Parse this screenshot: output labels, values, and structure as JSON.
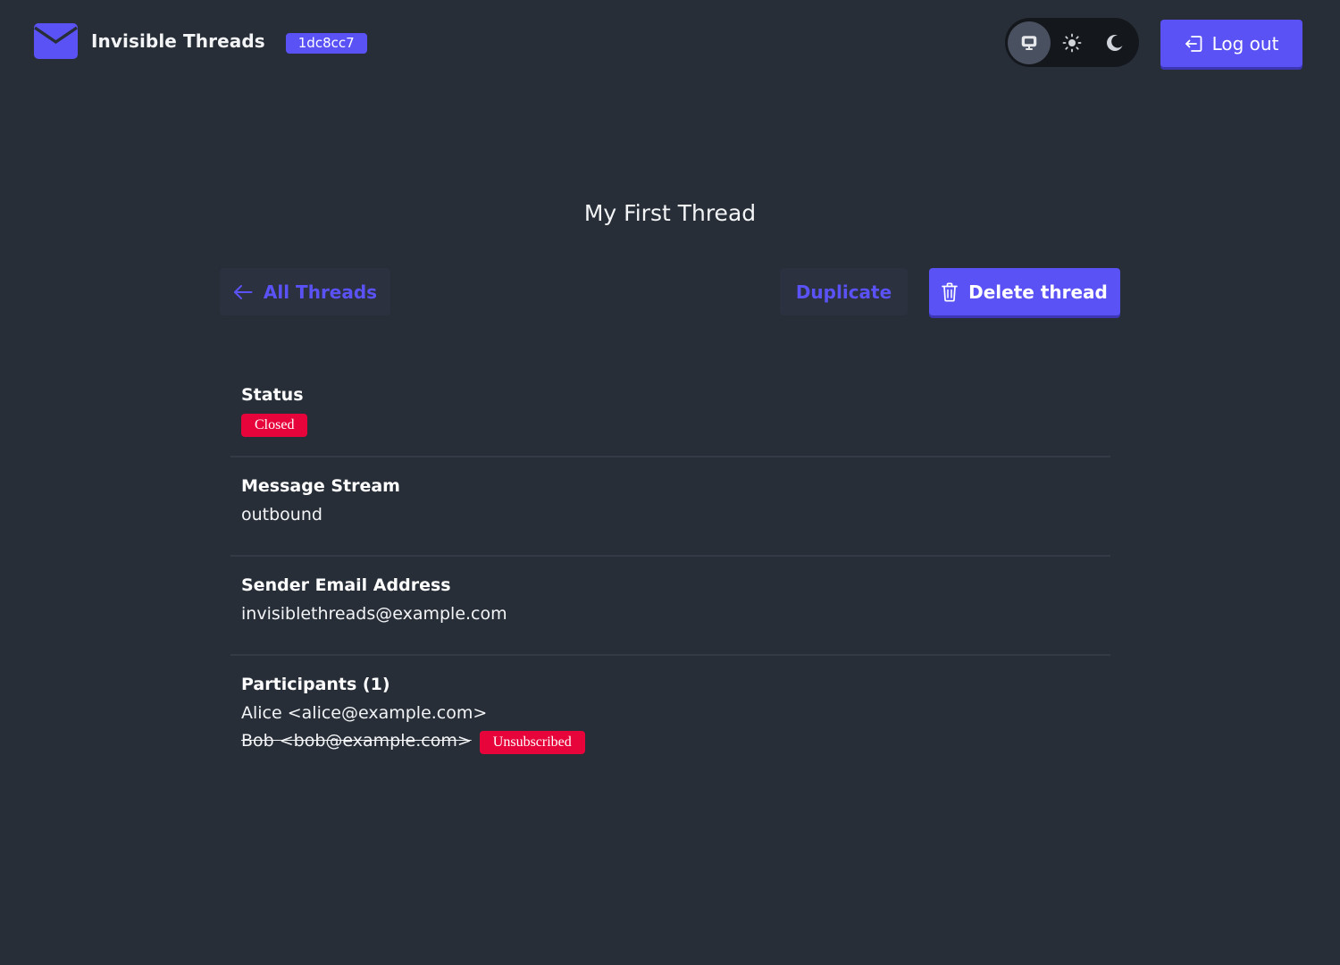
{
  "header": {
    "app_name": "Invisible Threads",
    "version": "1dc8cc7",
    "logo_icon": "envelope-icon",
    "theme_options": [
      {
        "name": "system",
        "icon": "monitor-icon",
        "active": true
      },
      {
        "name": "light",
        "icon": "sun-icon",
        "active": false
      },
      {
        "name": "dark",
        "icon": "moon-icon",
        "active": false
      }
    ],
    "logout_label": "Log out",
    "logout_icon": "logout-icon"
  },
  "page": {
    "title": "My First Thread"
  },
  "toolbar": {
    "back_label": "All Threads",
    "back_icon": "arrow-left-icon",
    "duplicate_label": "Duplicate",
    "delete_label": "Delete thread",
    "delete_icon": "trash-icon"
  },
  "details": {
    "status": {
      "label": "Status",
      "value": "Closed"
    },
    "message_stream": {
      "label": "Message Stream",
      "value": "outbound"
    },
    "sender": {
      "label": "Sender Email Address",
      "value": "invisiblethreads@example.com"
    },
    "participants": {
      "label": "Participants (1)",
      "items": [
        {
          "text": "Alice <alice@example.com>",
          "unsubscribed": false
        },
        {
          "text": "Bob <bob@example.com>",
          "unsubscribed": true,
          "badge": "Unsubscribed"
        }
      ]
    }
  },
  "colors": {
    "background": "#272e38",
    "accent": "#5a52f5",
    "danger": "#e6043b"
  }
}
